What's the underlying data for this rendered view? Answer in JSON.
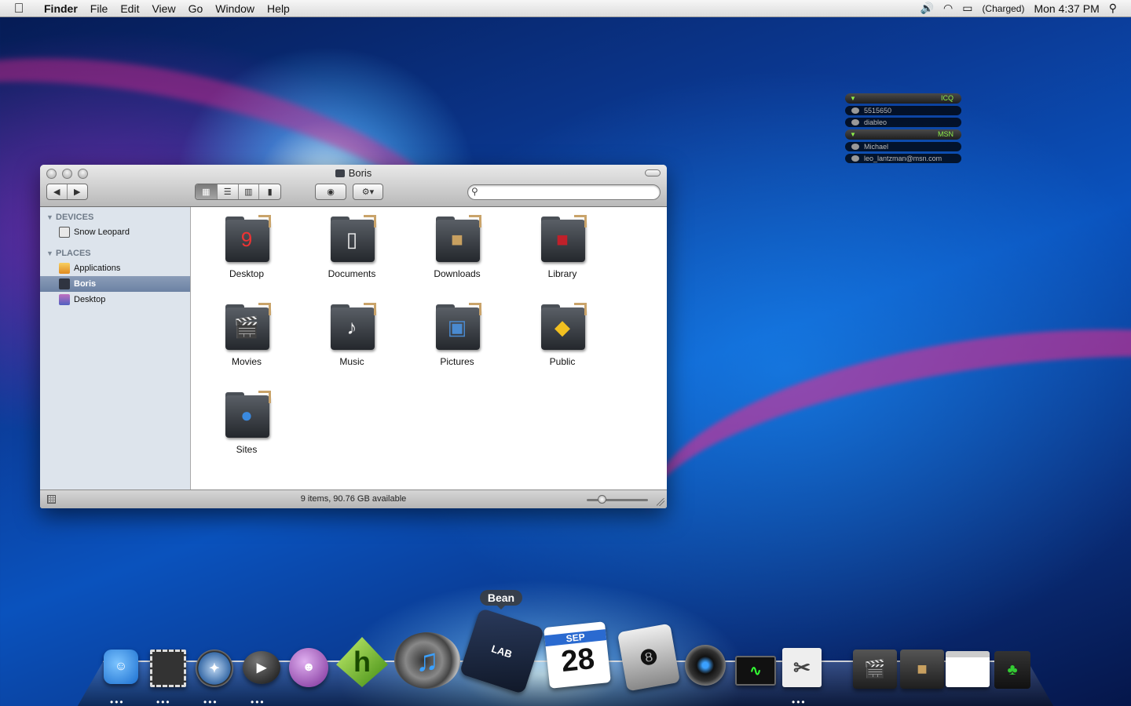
{
  "menubar": {
    "apple": "",
    "app": "Finder",
    "menus": [
      "File",
      "Edit",
      "View",
      "Go",
      "Window",
      "Help"
    ],
    "battery": "(Charged)",
    "clock": "Mon 4:37 PM"
  },
  "im": {
    "groups": [
      {
        "name": "ICQ",
        "contacts": [
          "5515650",
          "diableo"
        ]
      },
      {
        "name": "MSN",
        "contacts": [
          "Michael",
          "leo_lantzman@msn.com"
        ]
      }
    ]
  },
  "window": {
    "title": "Boris",
    "search_placeholder": "",
    "sidebar": {
      "devices_label": "DEVICES",
      "devices": [
        "Snow Leopard"
      ],
      "places_label": "PLACES",
      "places": [
        "Applications",
        "Boris",
        "Desktop"
      ],
      "selected": "Boris"
    },
    "items": [
      "Desktop",
      "Documents",
      "Downloads",
      "Library",
      "Movies",
      "Music",
      "Pictures",
      "Public",
      "Sites"
    ],
    "status": "9 items, 90.76 GB available",
    "icon_size_level": 0.25
  },
  "dock": {
    "tooltip": "Bean",
    "calendar_month": "SEP",
    "calendar_day": "28",
    "apps": [
      "finder-icon",
      "stamp-icon",
      "safari-icon",
      "ichat-icon",
      "people-icon",
      "hype-icon",
      "speaker-icon",
      "bean-notebook-icon",
      "ical-icon",
      "game-controller-icon",
      "camera-lens-icon",
      "activity-monitor-icon",
      "scissors-icon",
      "movies-stack-icon",
      "downloads-stack-icon",
      "preview-icon",
      "trash-icon"
    ]
  },
  "colors": {
    "im_green": "#8ef04a",
    "sidebar": "#dde4ec",
    "selection": "#6c82a4"
  }
}
